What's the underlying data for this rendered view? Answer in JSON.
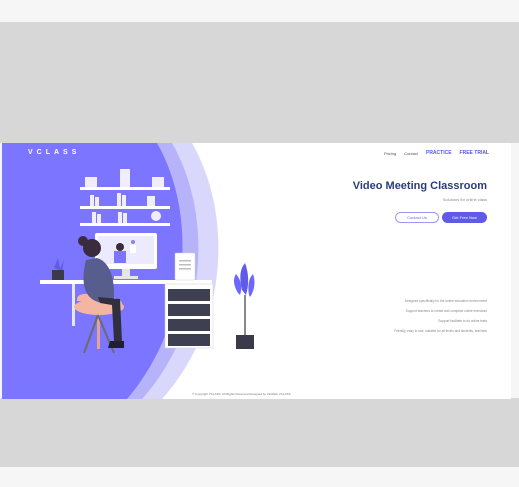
{
  "brand": "VCLASS",
  "nav": [
    "Pricing",
    "Contact",
    "PRACTICE",
    "FREE TRIAL"
  ],
  "hero": {
    "title": "Video Meeting Classroom",
    "subtitle": "Solutions for online class"
  },
  "buttons": {
    "secondary": "Contact Us",
    "primary": "Get Free Now"
  },
  "features": [
    "Designed specifically for the online education environment",
    "Support teachers to create and comprise online exercises",
    "Support facilitate to do online tests",
    "Friendly, easy to use, suitable for all levels and students, teachers"
  ],
  "footer": "© Copyright VCLASS. All Rights Reserved Designed by VietWeb VCLASS",
  "colors": {
    "brand_purple": "#7b75ff",
    "title_navy": "#2b3d78",
    "accent": "#5f5ae8",
    "letterbox_gray": "#d7d7d7"
  }
}
